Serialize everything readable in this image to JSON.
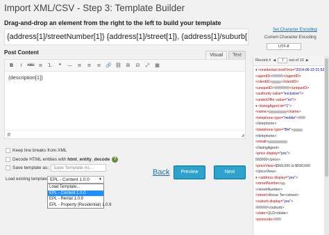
{
  "page": {
    "title": "Import XML/CSV - Step 3: Template Builder",
    "subtitle": "Drag-and-drop an element from the right to the left to build your template"
  },
  "template_title_value": "{address[1]/streetNumber[1]} {address[1]/street[1]}, {address[1]/suburb[1]",
  "post_content": {
    "label": "Post Content",
    "tabs": [
      "Visual",
      "Text"
    ],
    "toolbar": [
      "B",
      "I",
      "ABC",
      "≡",
      "1.",
      "❝",
      "—",
      "≡",
      "≡",
      "≡",
      "🔗",
      "⛓",
      "⊞",
      "⊟",
      "⤢",
      "▦"
    ],
    "content": "{description[1]}",
    "status": "p"
  },
  "options": {
    "keep_line_breaks": "Keep line breaks from XML",
    "decode_html_prefix": "Decode HTML entities with ",
    "decode_html_func": "html_entity_decode",
    "save_template_as": "Save template as:",
    "save_placeholder": "Save Template As..."
  },
  "load_template": {
    "label": "Load existing template:",
    "selected": "EPL - Content 1.0.0",
    "options": [
      "Load Template...",
      "EPL - Content 1.0.0",
      "EPL - Rental 1.0.9",
      "EPL - Property (Residential) 1.0.9"
    ]
  },
  "actions": {
    "back": "Back",
    "preview": "Preview",
    "next": "Next"
  },
  "encoding": {
    "set_link": "Set Character Encoding",
    "label": "Current Character Encoding",
    "value": "UTF-8"
  },
  "record_nav": {
    "label": "Record #",
    "current": "1",
    "of_text": "out of 10"
  },
  "xml_lines": [
    {
      "pre": "▾ ",
      "tag": "<residential",
      "attr": " modTime=",
      "val": "\"2014-06-22 01:52\"",
      "attr2": " status=",
      "val2": "\"current\"",
      "end": ">"
    },
    {
      "pre": "   ",
      "tag": "<agentID>",
      "blur": 16,
      "close": "</agentID>"
    },
    {
      "pre": "   ",
      "tag": "<clientID>",
      "blur": 14,
      "close": "</clientID>"
    },
    {
      "pre": "   ",
      "tag": "<uniqueID>",
      "blur": 22,
      "close": "</uniqueID>"
    },
    {
      "pre": "   ",
      "tag": "<authority",
      "attr": " value=",
      "val": "\"exclusive\"",
      "end": "/>"
    },
    {
      "pre": "   ",
      "tag": "<underOffer",
      "attr": " value=",
      "val": "\"no\"",
      "end": "/>"
    },
    {
      "pre": " ▾ ",
      "tag": "<listingAgent",
      "attr": " id=",
      "val": "\"1\"",
      "end": ">"
    },
    {
      "pre": "      ",
      "tag": "<name>",
      "blur": 26,
      "close": "</name>"
    },
    {
      "pre": "      ",
      "tag": "<telephone",
      "attr": " type=",
      "val": "\"mobile\"",
      "end": ">",
      "blur": 10
    },
    {
      "pre": "      ",
      "plain": "</telephone>"
    },
    {
      "pre": "      ",
      "tag": "<telephone",
      "attr": " type=",
      "val": "\"BH\"",
      "end": ">",
      "blur": 14
    },
    {
      "pre": "      ",
      "plain": "</telephone>"
    },
    {
      "pre": "      ",
      "tag": "<email>",
      "blur": 28,
      "close": ""
    },
    {
      "pre": "   ",
      "plain": "</listingAgent>"
    },
    {
      "pre": "   ",
      "tag": "<price",
      "attr": " display=",
      "val": "\"yes\"",
      "end": ">"
    },
    {
      "pre": "      ",
      "plain": "560000</price>"
    },
    {
      "pre": "   ",
      "tag": "<priceView>",
      "plain2": "$560,000 to $590,000"
    },
    {
      "pre": "      ",
      "plain": "</priceView>"
    },
    {
      "pre": " ▾ ",
      "tag": "<address",
      "attr": " display=",
      "val": "\"yes\"",
      "end": ">"
    },
    {
      "pre": "      ",
      "tag": "<streetNumber>",
      "blur": 6
    },
    {
      "pre": "      ",
      "plain": "</streetNumber>"
    },
    {
      "pre": "      ",
      "tag": "<street>",
      "plain2": "Anzac Ter</street>"
    },
    {
      "pre": "      ",
      "tag": "<suburb",
      "attr": " display=",
      "val": "\"yes\"",
      "end": ">"
    },
    {
      "pre": "      ",
      "blur": 18,
      "plain2": "</suburb>"
    },
    {
      "pre": "      ",
      "tag": "<state>",
      "plain2": "QLD</state>"
    },
    {
      "pre": "      ",
      "tag": "<postcode>",
      "blur": 10
    }
  ]
}
